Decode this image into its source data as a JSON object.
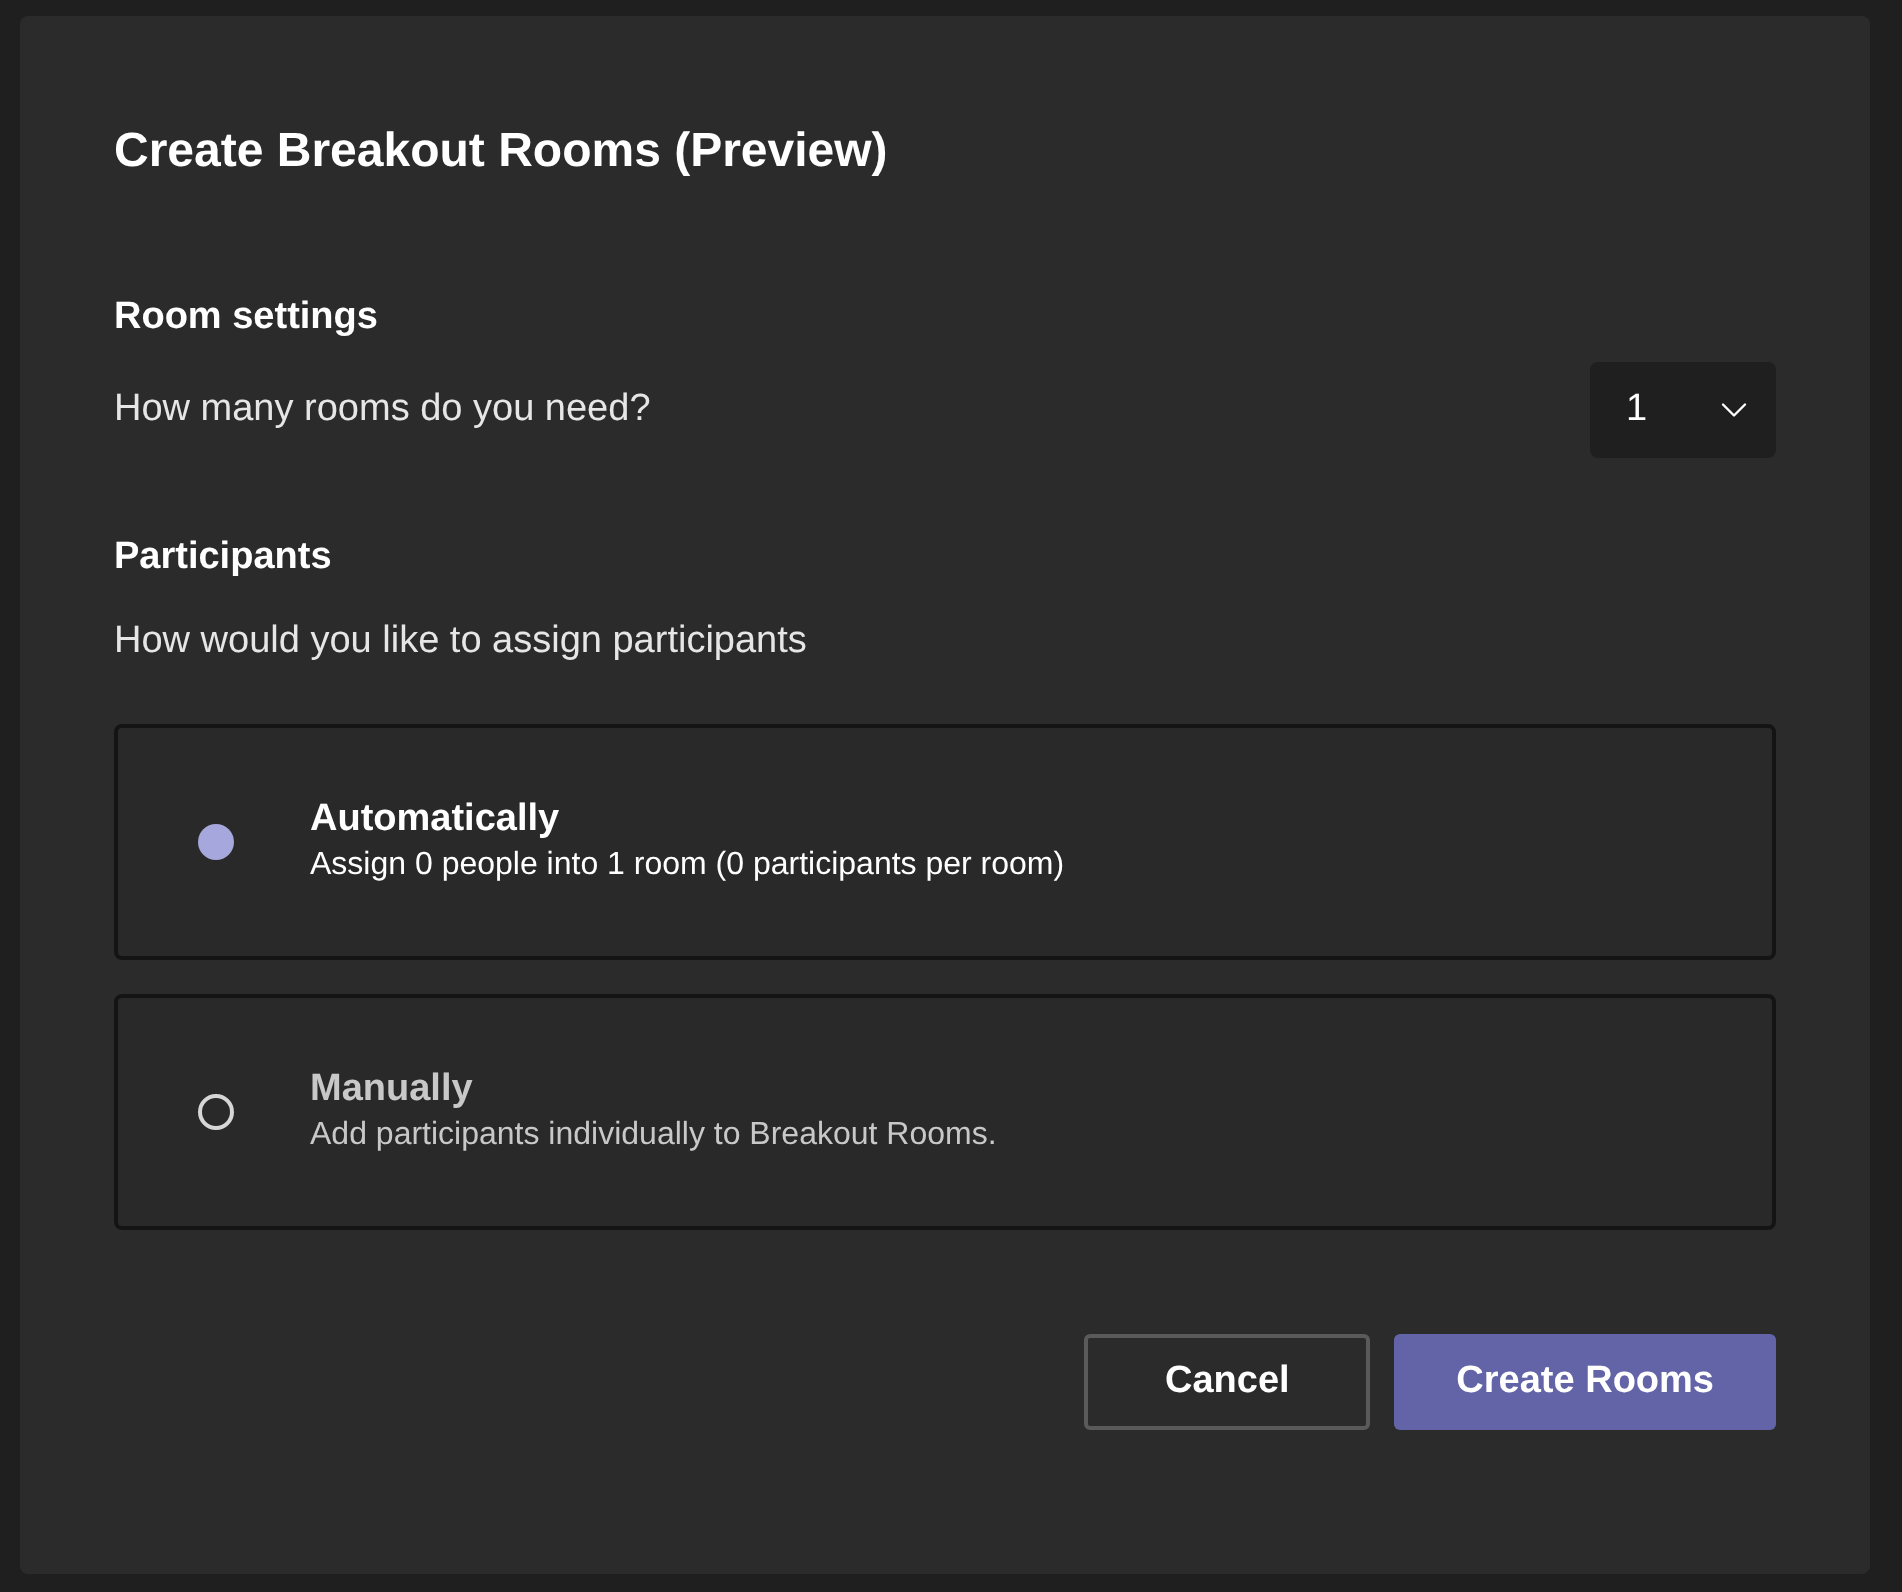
{
  "dialog": {
    "title": "Create Breakout Rooms (Preview)"
  },
  "room_settings": {
    "heading": "Room settings",
    "question": "How many rooms do you need?",
    "rooms_dropdown": {
      "value": "1"
    }
  },
  "participants": {
    "heading": "Participants",
    "question": "How would you like to assign participants",
    "options": [
      {
        "label": "Automatically",
        "description": "Assign 0 people into 1 room (0 participants per room)",
        "selected": true
      },
      {
        "label": "Manually",
        "description": "Add participants individually to Breakout Rooms.",
        "selected": false
      }
    ]
  },
  "buttons": [
    {
      "label": "Cancel",
      "kind": "secondary"
    },
    {
      "label": "Create Rooms",
      "kind": "primary"
    }
  ]
}
